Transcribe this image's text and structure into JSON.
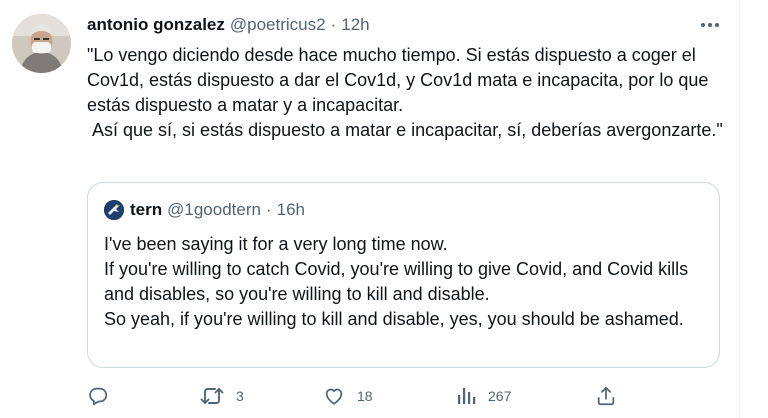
{
  "tweet": {
    "author_name": "antonio gonzalez",
    "author_handle": "@poetricus2",
    "separator": "·",
    "time": "12h",
    "text": "\"Lo vengo diciendo desde hace mucho tiempo. Si estás dispuesto a coger el Cov1d, estás dispuesto a dar el Cov1d, y Cov1d mata e incapacita, por lo que estás dispuesto a matar y a incapacitar.\n Así que sí, si estás dispuesto a matar e incapacitar, sí, deberías avergonzarte.\""
  },
  "quote": {
    "author_name": "tern",
    "author_handle": "@1goodtern",
    "separator": "·",
    "time": "16h",
    "text": "I've been saying it for a very long time now.\nIf you're willing to catch Covid, you're willing to give Covid, and Covid kills and disables, so you're willing to kill and disable.\nSo yeah, if you're willing to kill and disable, yes, you should be ashamed."
  },
  "actions": {
    "reply_icon": "reply-icon",
    "retweet_icon": "retweet-icon",
    "retweet_count": "3",
    "like_icon": "heart-icon",
    "like_count": "18",
    "views_icon": "views-icon",
    "views_count": "267",
    "share_icon": "share-icon"
  },
  "more_icon": "more-icon",
  "colors": {
    "text_primary": "#0f1419",
    "text_secondary": "#536471",
    "border": "#cfd9de"
  }
}
